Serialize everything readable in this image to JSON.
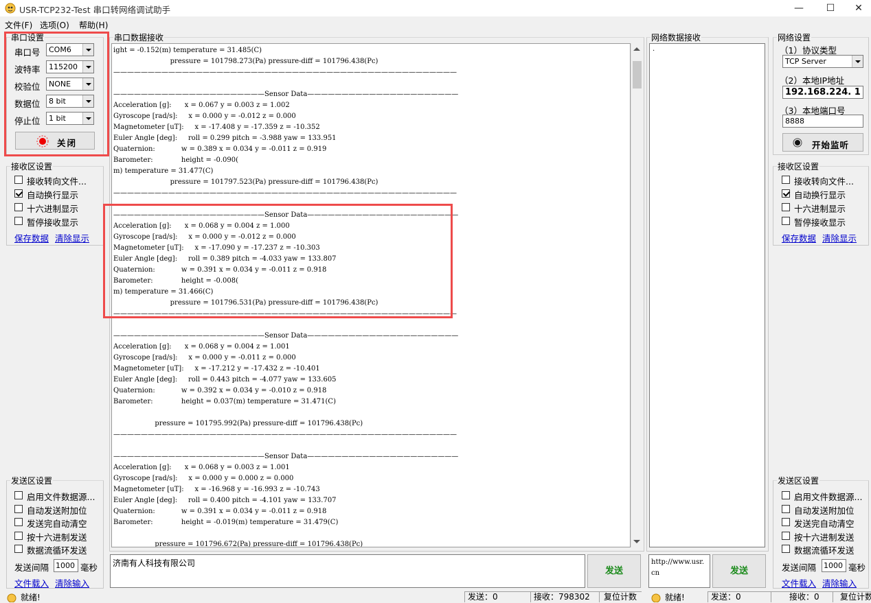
{
  "window": {
    "title": "USR-TCP232-Test 串口转网络调试助手",
    "minimize": "—",
    "maximize": "☐",
    "close": "✕"
  },
  "menu": {
    "file": "文件(F)",
    "options": "选项(O)",
    "help": "帮助(H)"
  },
  "serial_settings": {
    "legend": "串口设置",
    "port_label": "串口号",
    "port_value": "COM6",
    "baud_label": "波特率",
    "baud_value": "115200",
    "parity_label": "校验位",
    "parity_value": "NONE",
    "databits_label": "数据位",
    "databits_value": "8 bit",
    "stopbits_label": "停止位",
    "stopbits_value": "1 bit",
    "toggle_button": "关闭"
  },
  "left_recv_settings": {
    "legend": "接收区设置",
    "options": [
      {
        "label": "接收转向文件...",
        "checked": false
      },
      {
        "label": "自动换行显示",
        "checked": true
      },
      {
        "label": "十六进制显示",
        "checked": false
      },
      {
        "label": "暂停接收显示",
        "checked": false
      }
    ],
    "save_link": "保存数据",
    "clear_link": "清除显示"
  },
  "left_send_settings": {
    "legend": "发送区设置",
    "options": [
      {
        "label": "启用文件数据源...",
        "checked": false
      },
      {
        "label": "自动发送附加位",
        "checked": false
      },
      {
        "label": "发送完自动清空",
        "checked": false
      },
      {
        "label": "按十六进制发送",
        "checked": false
      },
      {
        "label": "数据流循环发送",
        "checked": false
      }
    ],
    "interval_label": "发送间隔",
    "interval_value": "1000",
    "interval_unit": "毫秒",
    "load_file_link": "文件载入",
    "clear_input_link": "清除输入"
  },
  "serial_recv": {
    "legend": "串口数据接收",
    "lines": [
      "ight = -0.152(m) temperature = 31.485(C)",
      "                          pressure = 101798.273(Pa) pressure-diff = 101796.438(Pc)",
      "——————————————————————————————————————————————————",
      "",
      "——————————————————————Sensor Data——————————————————————",
      "Acceleration [g]:      x = 0.067 y = 0.003 z = 1.002",
      "Gyroscope [rad/s]:     x = 0.000 y = -0.012 z = 0.000",
      "Magnetometer [uT]:     x = -17.408 y = -17.359 z = -10.352",
      "Euler Angle [deg]:     roll = 0.299 pitch = -3.988 yaw = 133.951",
      "Quaternion:            w = 0.389 x = 0.034 y = -0.011 z = 0.919",
      "Barometer:             height = -0.090(",
      "m) temperature = 31.477(C)",
      "                          pressure = 101797.523(Pa) pressure-diff = 101796.438(Pc)",
      "——————————————————————————————————————————————————",
      "",
      "——————————————————————Sensor Data——————————————————————",
      "Acceleration [g]:      x = 0.068 y = 0.004 z = 1.000",
      "Gyroscope [rad/s]:     x = 0.000 y = -0.012 z = 0.000",
      "Magnetometer [uT]:     x = -17.090 y = -17.237 z = -10.303",
      "Euler Angle [deg]:     roll = 0.389 pitch = -4.033 yaw = 133.807",
      "Quaternion:            w = 0.391 x = 0.034 y = -0.011 z = 0.918",
      "Barometer:             height = -0.008(",
      "m) temperature = 31.466(C)",
      "                          pressure = 101796.531(Pa) pressure-diff = 101796.438(Pc)",
      "——————————————————————————————————————————————————",
      "",
      "——————————————————————Sensor Data——————————————————————",
      "Acceleration [g]:      x = 0.068 y = 0.004 z = 1.001",
      "Gyroscope [rad/s]:     x = 0.000 y = -0.011 z = 0.000",
      "Magnetometer [uT]:     x = -17.212 y = -17.432 z = -10.401",
      "Euler Angle [deg]:     roll = 0.443 pitch = -4.077 yaw = 133.605",
      "Quaternion:            w = 0.392 x = 0.034 y = -0.010 z = 0.918",
      "Barometer:             height = 0.037(m) temperature = 31.471(C)",
      "",
      "                   pressure = 101795.992(Pa) pressure-diff = 101796.438(Pc)",
      "——————————————————————————————————————————————————",
      "",
      "——————————————————————Sensor Data——————————————————————",
      "Acceleration [g]:      x = 0.068 y = 0.003 z = 1.001",
      "Gyroscope [rad/s]:     x = 0.000 y = 0.000 z = 0.000",
      "Magnetometer [uT]:     x = -16.968 y = -16.993 z = -10.743",
      "Euler Angle [deg]:     roll = 0.400 pitch = -4.101 yaw = 133.707",
      "Quaternion:            w = 0.391 x = 0.034 y = -0.011 z = 0.918",
      "Barometer:             height = -0.019(m) temperature = 31.479(C)",
      "",
      "                   pressure = 101796.672(Pa) pressure-diff = 101796.438(Pc)"
    ]
  },
  "serial_send": {
    "text": "济南有人科技有限公司",
    "button": "发送"
  },
  "net_recv": {
    "legend": "网络数据接收",
    "text": "."
  },
  "net_send": {
    "text": "http://www.usr.cn",
    "button": "发送"
  },
  "net_settings": {
    "legend": "网络设置",
    "protocol_label": "（1）协议类型",
    "protocol_value": "TCP Server",
    "ip_label": "（2）本地IP地址",
    "ip_value": "192.168.224. 1",
    "port_label": "（3）本地端口号",
    "port_value": "8888",
    "listen_button": "开始监听"
  },
  "right_recv_settings": {
    "legend": "接收区设置",
    "options": [
      {
        "label": "接收转向文件...",
        "checked": false
      },
      {
        "label": "自动换行显示",
        "checked": true
      },
      {
        "label": "十六进制显示",
        "checked": false
      },
      {
        "label": "暂停接收显示",
        "checked": false
      }
    ],
    "save_link": "保存数据",
    "clear_link": "清除显示"
  },
  "right_send_settings": {
    "legend": "发送区设置",
    "options": [
      {
        "label": "启用文件数据源...",
        "checked": false
      },
      {
        "label": "自动发送附加位",
        "checked": false
      },
      {
        "label": "发送完自动清空",
        "checked": false
      },
      {
        "label": "按十六进制发送",
        "checked": false
      },
      {
        "label": "数据流循环发送",
        "checked": false
      }
    ],
    "interval_label": "发送间隔",
    "interval_value": "1000",
    "interval_unit": "毫秒",
    "load_file_link": "文件载入",
    "clear_input_link": "清除输入"
  },
  "status": {
    "left_ready": "就绪!",
    "left_send": "发送：0",
    "left_recv": "接收：798302",
    "left_reset": "复位计数",
    "right_ready": "就绪!",
    "right_send": "发送：0",
    "right_recv": "接收：0",
    "right_reset": "复位计数"
  },
  "colors": {
    "highlight_red": "#ee4b4b",
    "send_button_text": "#1a8a1a",
    "link_blue": "#0000cc"
  }
}
